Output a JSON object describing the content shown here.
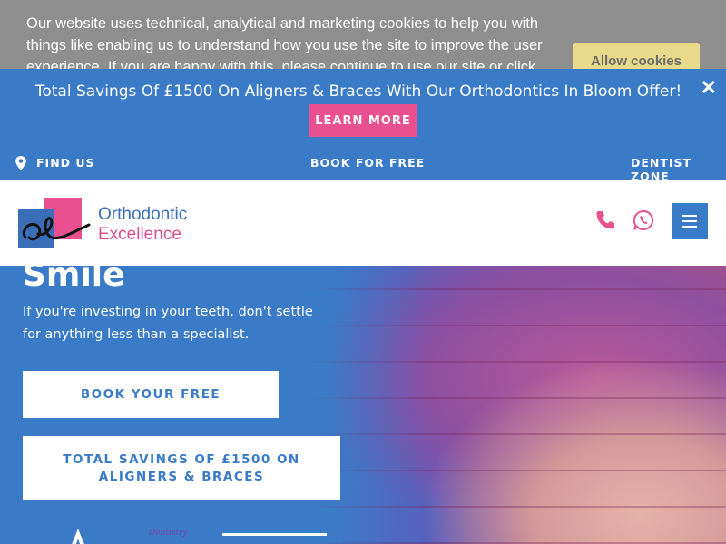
{
  "cookie_banner": {
    "text": "Our website uses technical, analytical and marketing cookies to help you with things like enabling us to understand how you use the site to improve the user experience. If you are happy with this, please continue to use our site or click 'Allow cookies'",
    "allow_label": "Allow cookies"
  },
  "promo": {
    "text": "Total Savings Of £1500 On Aligners & Braces With Our Orthodontics In Bloom Offer!",
    "button_label": "LEARN MORE",
    "close_glyph": "✕"
  },
  "topnav": {
    "find_us": "FIND US",
    "book": "BOOK FOR FREE",
    "dentist_zone": "DENTIST ZONE"
  },
  "header": {
    "logo_line1": "Orthodontic",
    "logo_line2": "Excellence",
    "icons": [
      "phone-icon",
      "whatsapp-icon",
      "menu-icon"
    ]
  },
  "hero": {
    "title": "Smile",
    "subtitle": "If you're investing in your teeth, don't settle for anything less than a specialist.",
    "cta_primary": "BOOK YOUR FREE CONSULTATION",
    "cta_secondary": "TOTAL SAVINGS OF £1500 ON ALIGNERS & BRACES",
    "badge_text": "Dentistry"
  },
  "colors": {
    "brand_blue": "#3a7bc8",
    "brand_pink": "#e8508f",
    "cookie_gray": "#8e8e8e",
    "cookie_button": "#e9d98a"
  }
}
